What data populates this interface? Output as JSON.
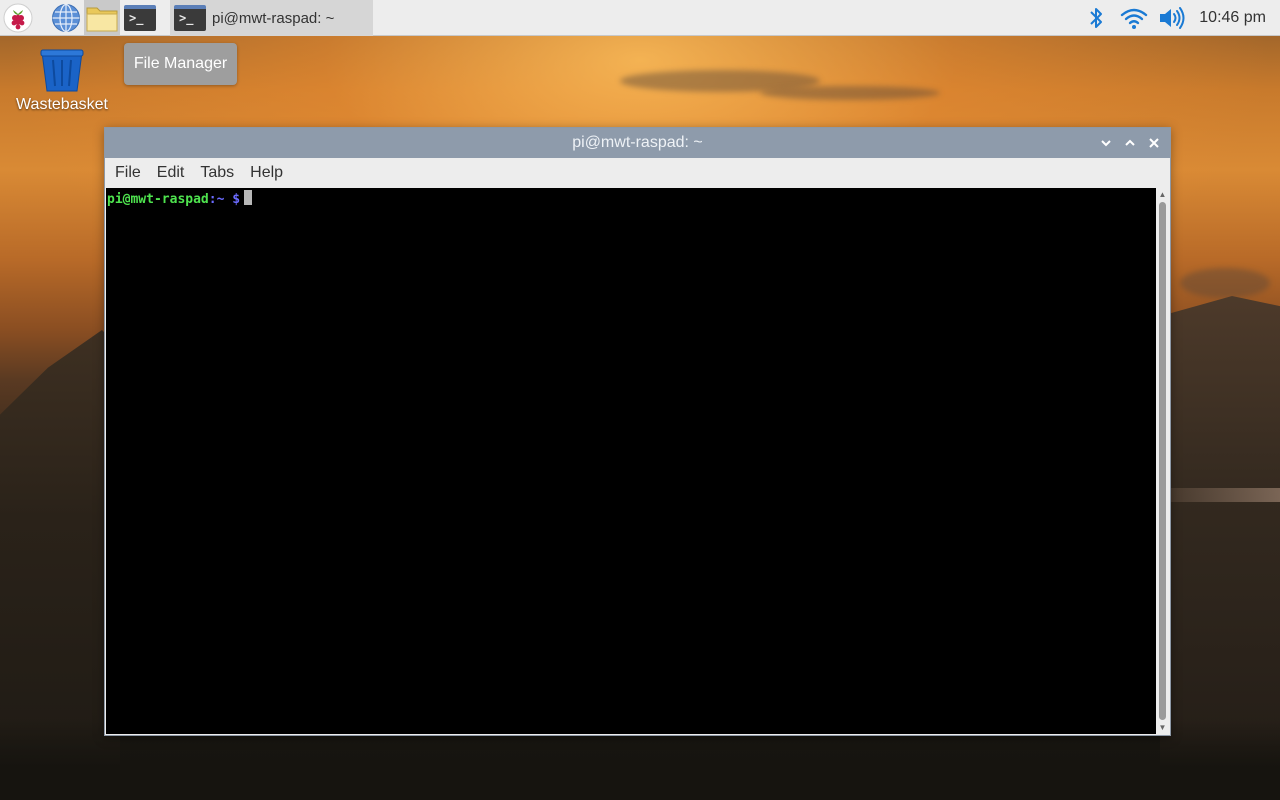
{
  "taskbar": {
    "launchers": [
      {
        "icon": "raspberry-pi-menu-icon"
      },
      {
        "icon": "web-browser-globe-icon"
      },
      {
        "icon": "file-manager-folder-icon"
      },
      {
        "icon": "terminal-icon",
        "glyph": ">_"
      }
    ],
    "task_button": {
      "label": "pi@mwt-raspad: ~",
      "glyph": ">_"
    },
    "tray": {
      "bluetooth_icon": "bluetooth-icon",
      "wifi_icon": "wifi-icon",
      "volume_icon": "volume-icon",
      "clock": "10:46 pm"
    },
    "accent_color": "#1a7ad4"
  },
  "tooltip": {
    "text": "File Manager"
  },
  "desktop": {
    "icons": [
      {
        "label": "Wastebasket",
        "icon": "wastebasket-icon"
      }
    ]
  },
  "window": {
    "title": "pi@mwt-raspad: ~",
    "controls": [
      "minimize",
      "maximize",
      "close"
    ],
    "menu": [
      "File",
      "Edit",
      "Tabs",
      "Help"
    ],
    "terminal": {
      "prompt_user": "pi@mwt-raspad",
      "prompt_path": ":~",
      "prompt_symbol": "$",
      "user_color": "#4ee34e",
      "path_color": "#6b6bff"
    }
  }
}
